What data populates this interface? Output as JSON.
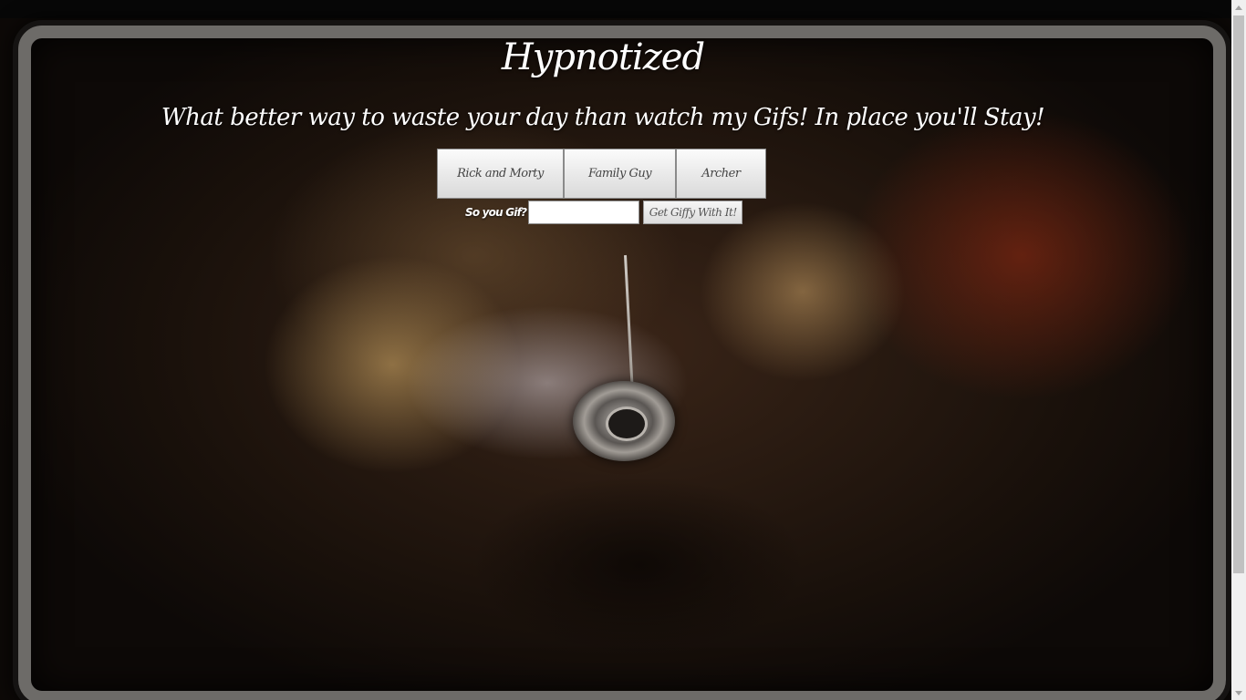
{
  "page": {
    "title": "Hypnotized",
    "subtitle": "What better way to waste your day than watch my Gifs! In place you'll Stay!"
  },
  "shows": [
    {
      "label": "Rick and Morty"
    },
    {
      "label": "Family Guy"
    },
    {
      "label": "Archer"
    }
  ],
  "search": {
    "label": "So you Gif?",
    "value": "",
    "placeholder": "",
    "submit_label": "Get Giffy With It!"
  },
  "colors": {
    "text": "#ffffff",
    "button_bg": "#e6e6e6",
    "frame": "#6d6b68",
    "background": "#1a110b"
  },
  "scrollbar": {
    "up_icon": "chevron-up-icon",
    "down_icon": "chevron-down-icon",
    "position_fraction": 0
  }
}
